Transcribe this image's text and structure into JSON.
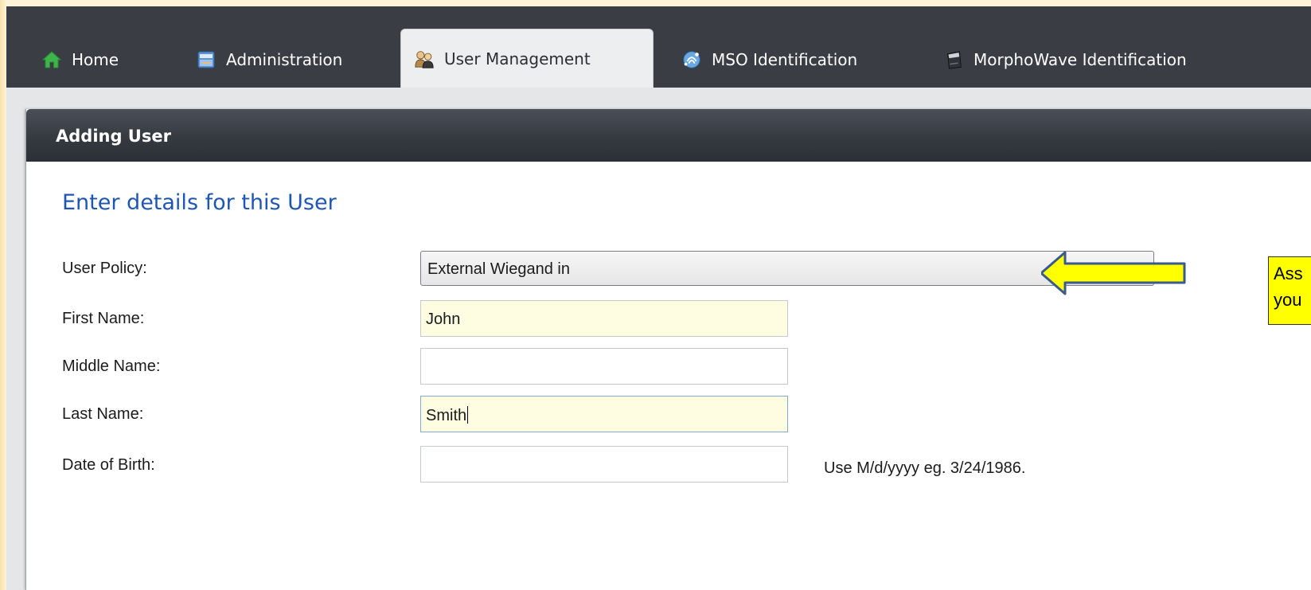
{
  "tabs": [
    {
      "label": "Home",
      "icon": "home-icon"
    },
    {
      "label": "Administration",
      "icon": "administration-icon"
    },
    {
      "label": "User Management",
      "icon": "users-icon",
      "active": true
    },
    {
      "label": "MSO Identification",
      "icon": "fingerprint-icon"
    },
    {
      "label": "MorphoWave Identification",
      "icon": "morphowave-device-icon"
    }
  ],
  "panel": {
    "title": "Adding User",
    "section_title": "Enter details for this User"
  },
  "form": {
    "user_policy": {
      "label": "User Policy:",
      "value": "External Wiegand in"
    },
    "first_name": {
      "label": "First Name:",
      "value": "John"
    },
    "middle_name": {
      "label": "Middle Name:",
      "value": ""
    },
    "last_name": {
      "label": "Last Name:",
      "value": "Smith"
    },
    "date_of_birth": {
      "label": "Date of Birth:",
      "value": "",
      "hint": "Use M/d/yyyy eg. 3/24/1986."
    }
  },
  "callout": {
    "line1": "Ass",
    "line2": "you"
  },
  "colors": {
    "tabbar": "#3a3d44",
    "accent_blue": "#1f56b4",
    "callout_yellow": "#ffff00",
    "filled_field": "#fefde2"
  }
}
